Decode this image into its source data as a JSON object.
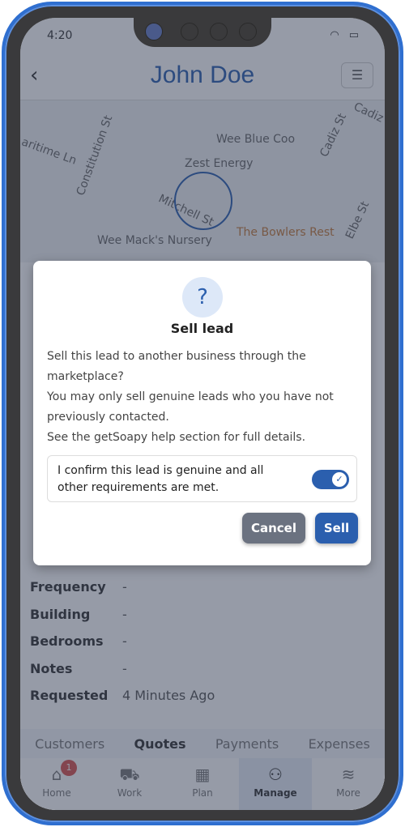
{
  "status": {
    "time": "4:20",
    "wifi_icon": "wifi-icon",
    "battery_icon": "battery-icon"
  },
  "header": {
    "title": "John Doe",
    "back_icon": "‹",
    "menu_icon": "☰"
  },
  "map": {
    "labels": [
      "Wee Blue Coo",
      "Zest Energy",
      "Mitchell St",
      "Constitution St",
      "aritime Ln",
      "Cadiz St",
      "Cadiz S",
      "Wee Mack's Nursery",
      "The Bowlers Rest",
      "Elbe St"
    ]
  },
  "details": [
    {
      "k": "Frequency",
      "v": "-"
    },
    {
      "k": "Building",
      "v": "-"
    },
    {
      "k": "Bedrooms",
      "v": "-"
    },
    {
      "k": "Notes",
      "v": "-"
    },
    {
      "k": "Requested",
      "v": "4 Minutes Ago"
    }
  ],
  "subtabs": [
    "Customers",
    "Quotes",
    "Payments",
    "Expenses"
  ],
  "nav": [
    {
      "label": "Home",
      "icon": "⌂",
      "badge": "1"
    },
    {
      "label": "Work",
      "icon": "⛟"
    },
    {
      "label": "Plan",
      "icon": "▦"
    },
    {
      "label": "Manage",
      "icon": "⚇"
    },
    {
      "label": "More",
      "icon": "≋"
    }
  ],
  "dialog": {
    "icon": "?",
    "title": "Sell lead",
    "lines": [
      "Sell this lead to another business through the marketplace?",
      "You may only sell genuine leads who you have not previously contacted.",
      "See the getSoapy help section for full details."
    ],
    "confirm": "I confirm this lead is genuine and all other requirements are met.",
    "toggle_on": true,
    "cancel": "Cancel",
    "sell": "Sell"
  },
  "colors": {
    "accent": "#2b5fae",
    "frame": "#2f6fd0",
    "cancel": "#6b7280"
  }
}
